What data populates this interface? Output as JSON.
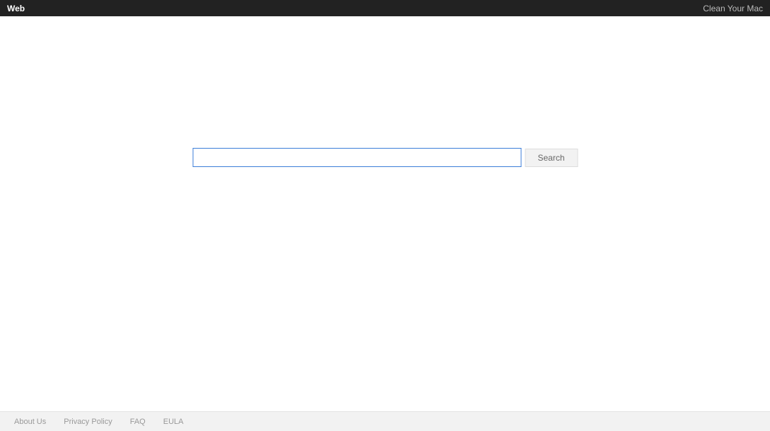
{
  "header": {
    "title": "Web",
    "right_link": "Clean Your Mac"
  },
  "search": {
    "value": "",
    "button_label": "Search"
  },
  "footer": {
    "links": [
      "About Us",
      "Privacy Policy",
      "FAQ",
      "EULA"
    ]
  }
}
